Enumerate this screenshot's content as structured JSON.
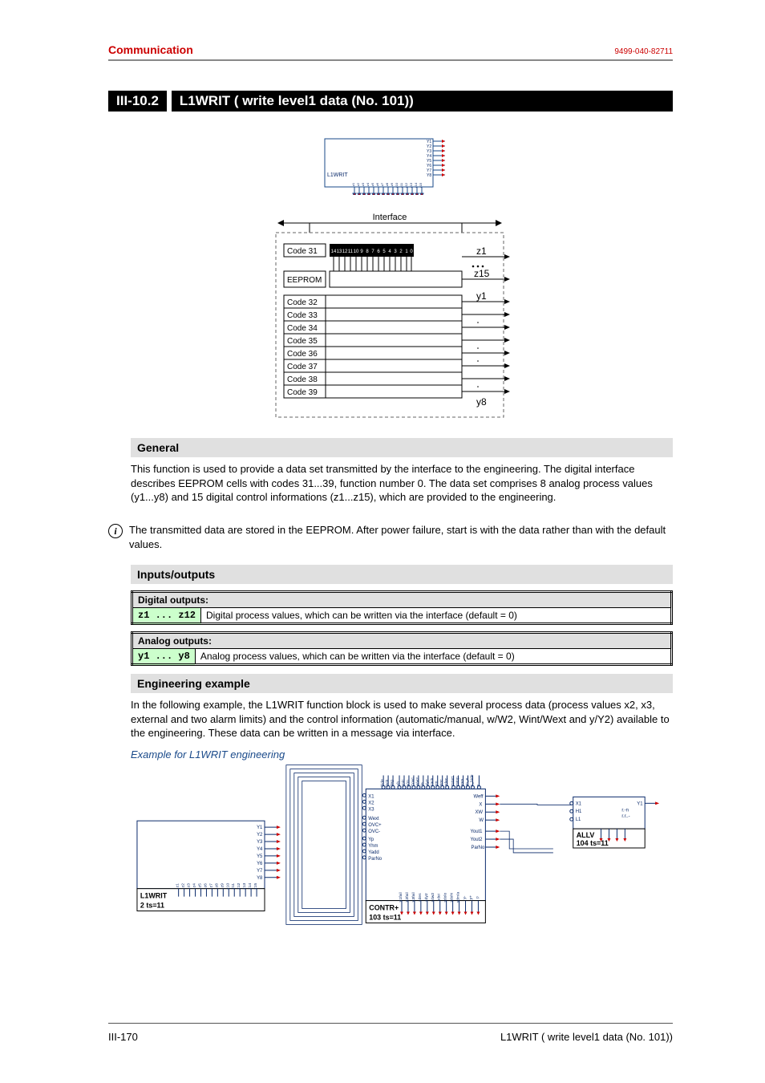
{
  "header": {
    "section": "Communication",
    "docnum": "9499-040-82711"
  },
  "title": {
    "num": "III-10.2",
    "text": "L1WRIT ( write level1 data (No. 101))"
  },
  "fb_symbol": {
    "name": "L1WRIT",
    "y_labels": [
      "Y1",
      "Y2",
      "Y3",
      "Y4",
      "Y5",
      "Y6",
      "Y7",
      "Y8"
    ]
  },
  "block_diagram": {
    "interface_label": "Interface",
    "rows": [
      "Code 31",
      "EEPROM",
      "Code 32",
      "Code 33",
      "Code 34",
      "Code 35",
      "Code 36",
      "Code 37",
      "Code 38",
      "Code 39"
    ],
    "bits": [
      "14",
      "13",
      "12",
      "11",
      "10",
      "9",
      "8",
      "7",
      "6",
      "5",
      "4",
      "3",
      "2",
      "1",
      "0"
    ],
    "out_top": [
      "z1",
      "z15"
    ],
    "out_y": [
      "y1",
      "y8"
    ]
  },
  "general": {
    "heading": "General",
    "p1": "This function is used to provide a data set transmitted by the interface to the engineering. The digital interface describes EEPROM cells with codes 31...39, function number 0. The data set comprises 8 analog process values (y1...y8) and 15 digital control informations (z1...z15), which are provided to the engineering.",
    "p2": "The transmitted data are stored in the EEPROM. After power failure, start is with the data rather than with the default values."
  },
  "io": {
    "heading": "Inputs/outputs",
    "digital": {
      "title": "Digital outputs:",
      "row_label": "z1 ... z12",
      "row_desc": "Digital process values, which can be written via the interface (default = 0)"
    },
    "analog": {
      "title": "Analog outputs:",
      "row_label": "y1 ... y8",
      "row_desc": "Analog process values, which can be written via the interface (default = 0)"
    }
  },
  "engineering": {
    "heading": "Engineering example",
    "p1": "In the following example, the L1WRIT function block is used to make several process data (process values x2, x3, external and two alarm limits) and the control information (automatic/manual, w/W2, Wint/Wext and y/Y2) available to the engineering. These data can be written in a message via interface.",
    "caption": "Example for L1WRIT engineering"
  },
  "example_diagram": {
    "l1writ": {
      "name": "L1WRIT",
      "sub": "2 ts=11"
    },
    "contr": {
      "name": "CONTR+",
      "sub": "103 ts=11"
    },
    "allv": {
      "name": "ALLV",
      "sub": "104 ts=11"
    }
  },
  "footer": {
    "left": "III-170",
    "right": "L1WRIT ( write level1 data (No. 101))"
  }
}
